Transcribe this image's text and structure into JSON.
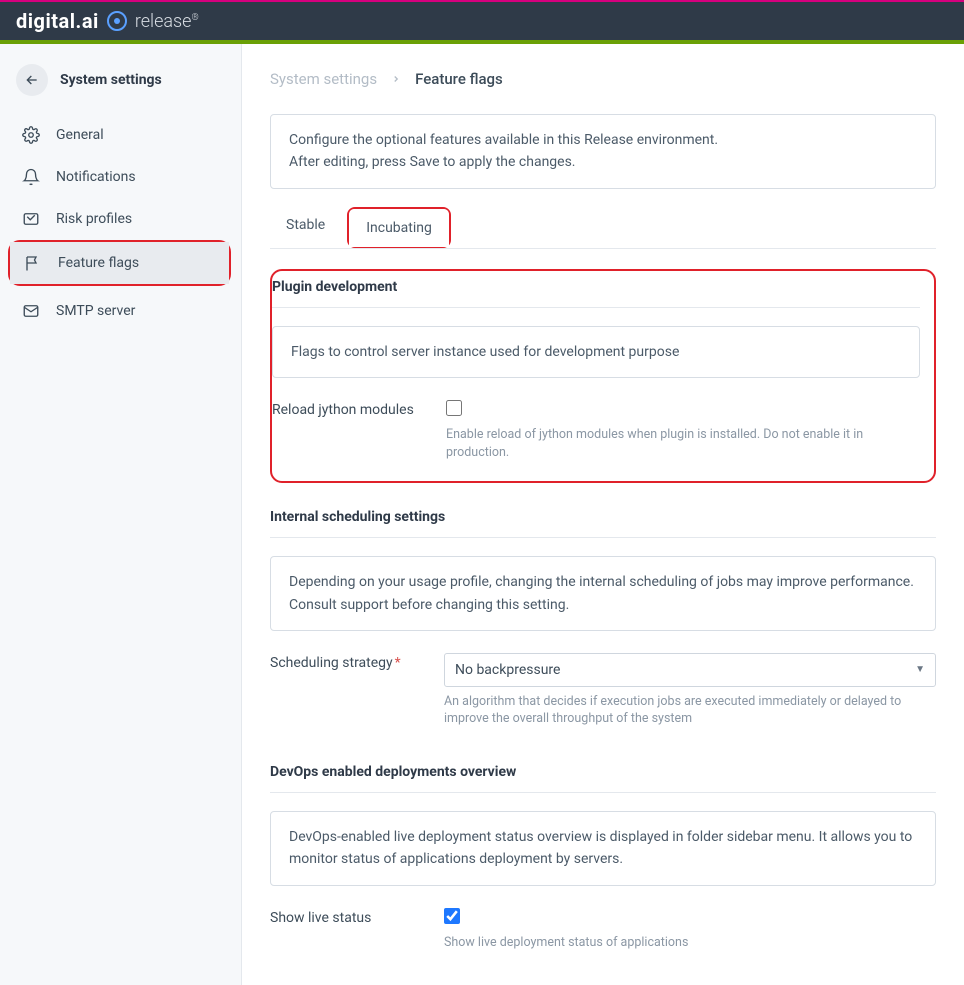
{
  "header": {
    "brand_main": "digital",
    "brand_suffix": ".ai",
    "brand_product": "release"
  },
  "sidebar": {
    "title": "System settings",
    "items": [
      {
        "label": "General"
      },
      {
        "label": "Notifications"
      },
      {
        "label": "Risk profiles"
      },
      {
        "label": "Feature flags"
      },
      {
        "label": "SMTP server"
      }
    ]
  },
  "breadcrumb": {
    "parent": "System settings",
    "current": "Feature flags"
  },
  "intro": {
    "line1": "Configure the optional features available in this Release environment.",
    "line2": "After editing, press Save to apply the changes."
  },
  "tabs": {
    "stable": "Stable",
    "incubating": "Incubating"
  },
  "plugin_dev": {
    "title": "Plugin development",
    "desc": "Flags to control server instance used for development purpose",
    "reload_label": "Reload jython modules",
    "reload_hint": "Enable reload of jython modules when plugin is installed. Do not enable it in production."
  },
  "scheduling": {
    "title": "Internal scheduling settings",
    "desc": "Depending on your usage profile, changing the internal scheduling of jobs may improve performance. Consult support before changing this setting.",
    "strategy_label": "Scheduling strategy",
    "strategy_value": "No backpressure",
    "strategy_hint": "An algorithm that decides if execution jobs are executed immediately or delayed to improve the overall throughput of the system"
  },
  "devops": {
    "title": "DevOps enabled deployments overview",
    "desc": "DevOps-enabled live deployment status overview is displayed in folder sidebar menu. It allows you to monitor status of applications deployment by servers.",
    "show_live_label": "Show live status",
    "show_live_hint": "Show live deployment status of applications"
  }
}
